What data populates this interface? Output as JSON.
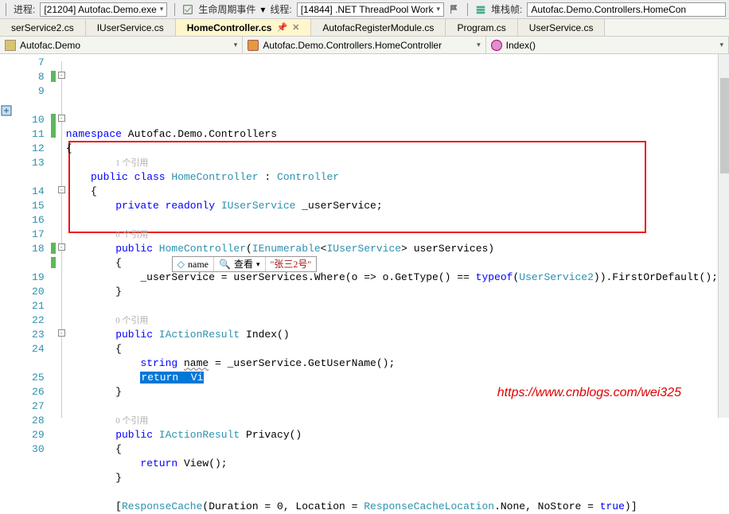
{
  "toolbar": {
    "process_label": "进程:",
    "process_value": "[21204] Autofac.Demo.exe",
    "lifecycle_label": "生命周期事件",
    "thread_label": "线程:",
    "thread_value": "[14844] .NET ThreadPool Work",
    "stackframe_label": "堆栈帧:",
    "stackframe_value": "Autofac.Demo.Controllers.HomeCon"
  },
  "tabs": [
    {
      "label": "serService2.cs"
    },
    {
      "label": "IUserService.cs"
    },
    {
      "label": "HomeController.cs",
      "active": true
    },
    {
      "label": "AutofacRegisterModule.cs"
    },
    {
      "label": "Program.cs"
    },
    {
      "label": "UserService.cs"
    }
  ],
  "navbar": {
    "project": "Autofac.Demo",
    "class": "Autofac.Demo.Controllers.HomeController",
    "member": "Index()"
  },
  "code": {
    "lines": [
      {
        "n": 7,
        "text": ""
      },
      {
        "n": 8,
        "text_parts": [
          {
            "t": "namespace",
            "c": "kw"
          },
          {
            "t": " Autofac.Demo.Controllers"
          }
        ]
      },
      {
        "n": 9,
        "text": "{"
      },
      {
        "ref": "1 个引用"
      },
      {
        "n": 10,
        "text_parts": [
          {
            "t": "    "
          },
          {
            "t": "public class ",
            "c": "kw"
          },
          {
            "t": "HomeController",
            "c": "typ"
          },
          {
            "t": " : "
          },
          {
            "t": "Controller",
            "c": "typ"
          }
        ]
      },
      {
        "n": 11,
        "text": "    {"
      },
      {
        "n": 12,
        "text_parts": [
          {
            "t": "        "
          },
          {
            "t": "private readonly ",
            "c": "kw"
          },
          {
            "t": "IUserService",
            "c": "typ"
          },
          {
            "t": " _userService;"
          }
        ]
      },
      {
        "n": 13,
        "text": ""
      },
      {
        "ref": "0 个引用"
      },
      {
        "n": 14,
        "text_parts": [
          {
            "t": "        "
          },
          {
            "t": "public ",
            "c": "kw"
          },
          {
            "t": "HomeController",
            "c": "typ"
          },
          {
            "t": "("
          },
          {
            "t": "IEnumerable",
            "c": "typ"
          },
          {
            "t": "<"
          },
          {
            "t": "IUserService",
            "c": "typ"
          },
          {
            "t": "> userServices)"
          }
        ]
      },
      {
        "n": 15,
        "text": "        {"
      },
      {
        "n": 16,
        "text_parts": [
          {
            "t": "            _userService = userServices.Where(o => o.GetType() == "
          },
          {
            "t": "typeof",
            "c": "kw"
          },
          {
            "t": "("
          },
          {
            "t": "UserService2",
            "c": "typ"
          },
          {
            "t": ")).FirstOrDefault();"
          }
        ]
      },
      {
        "n": 17,
        "text": "        }"
      },
      {
        "n": 18,
        "text": ""
      },
      {
        "ref": "0 个引用"
      },
      {
        "n": 19,
        "text_parts": [
          {
            "t": "        "
          },
          {
            "t": "public ",
            "c": "kw"
          },
          {
            "t": "IActionResult",
            "c": "typ"
          },
          {
            "t": " Index()"
          }
        ]
      },
      {
        "n": 20,
        "text": "        {"
      },
      {
        "n": 21,
        "text_parts": [
          {
            "t": "            "
          },
          {
            "t": "string ",
            "c": "kw"
          },
          {
            "t": "name",
            "u": true
          },
          {
            "t": " = _userService.GetUserName();"
          }
        ]
      },
      {
        "n": 22,
        "text_parts": [
          {
            "t": "            "
          },
          {
            "t": "return  Vi",
            "c": "hl"
          }
        ]
      },
      {
        "n": 23,
        "text": "        }"
      },
      {
        "n": 24,
        "text": ""
      },
      {
        "ref": "0 个引用"
      },
      {
        "n": 25,
        "text_parts": [
          {
            "t": "        "
          },
          {
            "t": "public ",
            "c": "kw"
          },
          {
            "t": "IActionResult",
            "c": "typ"
          },
          {
            "t": " Privacy()"
          }
        ]
      },
      {
        "n": 26,
        "text": "        {"
      },
      {
        "n": 27,
        "text_parts": [
          {
            "t": "            "
          },
          {
            "t": "return ",
            "c": "kw"
          },
          {
            "t": "View();"
          }
        ]
      },
      {
        "n": 28,
        "text": "        }"
      },
      {
        "n": 29,
        "text": ""
      },
      {
        "n": 30,
        "text_parts": [
          {
            "t": "        ["
          },
          {
            "t": "ResponseCache",
            "c": "typ"
          },
          {
            "t": "(Duration = 0, Location = "
          },
          {
            "t": "ResponseCacheLocation",
            "c": "typ"
          },
          {
            "t": ".None, NoStore = "
          },
          {
            "t": "true",
            "c": "kw"
          },
          {
            "t": ")]"
          }
        ]
      }
    ]
  },
  "tooltip": {
    "var_icon": "◇",
    "var_name": "name",
    "view_label": "查看",
    "value": "\"张三2号\""
  },
  "watermark": "https://www.cnblogs.com/wei325"
}
